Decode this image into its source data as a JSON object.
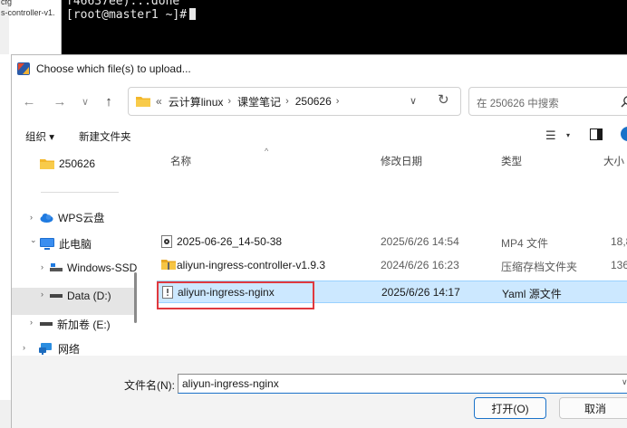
{
  "background": {
    "left_lines": [
      "cfg",
      "s-controller-v1."
    ],
    "terminal_lines": [
      "f46637ee)...done",
      "[root@master1 ~]#"
    ]
  },
  "dialog": {
    "title": "Choose which file(s) to upload...",
    "nav": {
      "back": "←",
      "forward": "→",
      "history": "∨",
      "up": "↑",
      "breadcrumb_prefix": "«",
      "breadcrumbs": [
        "云计算linux",
        "课堂笔记",
        "250626"
      ],
      "crumb_sep": "›",
      "dropdown": "∨",
      "refresh": "↻",
      "search_placeholder": "在 250626 中搜索"
    },
    "toolbar": {
      "organize": "组织 ▾",
      "new_folder": "新建文件夹",
      "view": "☰",
      "view_caret": "▾"
    },
    "navpane": {
      "items": [
        {
          "label": "250626",
          "icon": "folder-icon"
        },
        {
          "label": "WPS云盘",
          "icon": "cloud-icon"
        },
        {
          "label": "此电脑",
          "icon": "computer-icon"
        },
        {
          "label": "Windows-SSD",
          "icon": "drive-icon"
        },
        {
          "label": "Data (D:)",
          "icon": "drive-icon"
        },
        {
          "label": "新加卷 (E:)",
          "icon": "drive-icon"
        },
        {
          "label": "网络",
          "icon": "network-icon"
        }
      ],
      "chevron_right": "›",
      "chevron_down": "⌄"
    },
    "columns": {
      "name": "名称",
      "modified": "修改日期",
      "type": "类型",
      "size": "大小",
      "sort_caret": "^"
    },
    "files": [
      {
        "name": "2025-06-26_14-50-38",
        "modified": "2025/6/26 14:54",
        "type": "MP4 文件",
        "size": "18,8",
        "icon": "video-file-icon"
      },
      {
        "name": "aliyun-ingress-controller-v1.9.3",
        "modified": "2024/6/26 16:23",
        "type": "压缩存档文件夹",
        "size": "136,",
        "icon": "zip-folder-icon"
      },
      {
        "name": "aliyun-ingress-nginx",
        "modified": "2025/6/26 14:17",
        "type": "Yaml 源文件",
        "size": "",
        "icon": "yaml-file-icon"
      }
    ],
    "footer": {
      "filename_label": "文件名(N):",
      "filename_value": "aliyun-ingress-nginx",
      "filename_caret": "∨",
      "open_label": "打开(O)",
      "cancel_label": "取消"
    }
  }
}
